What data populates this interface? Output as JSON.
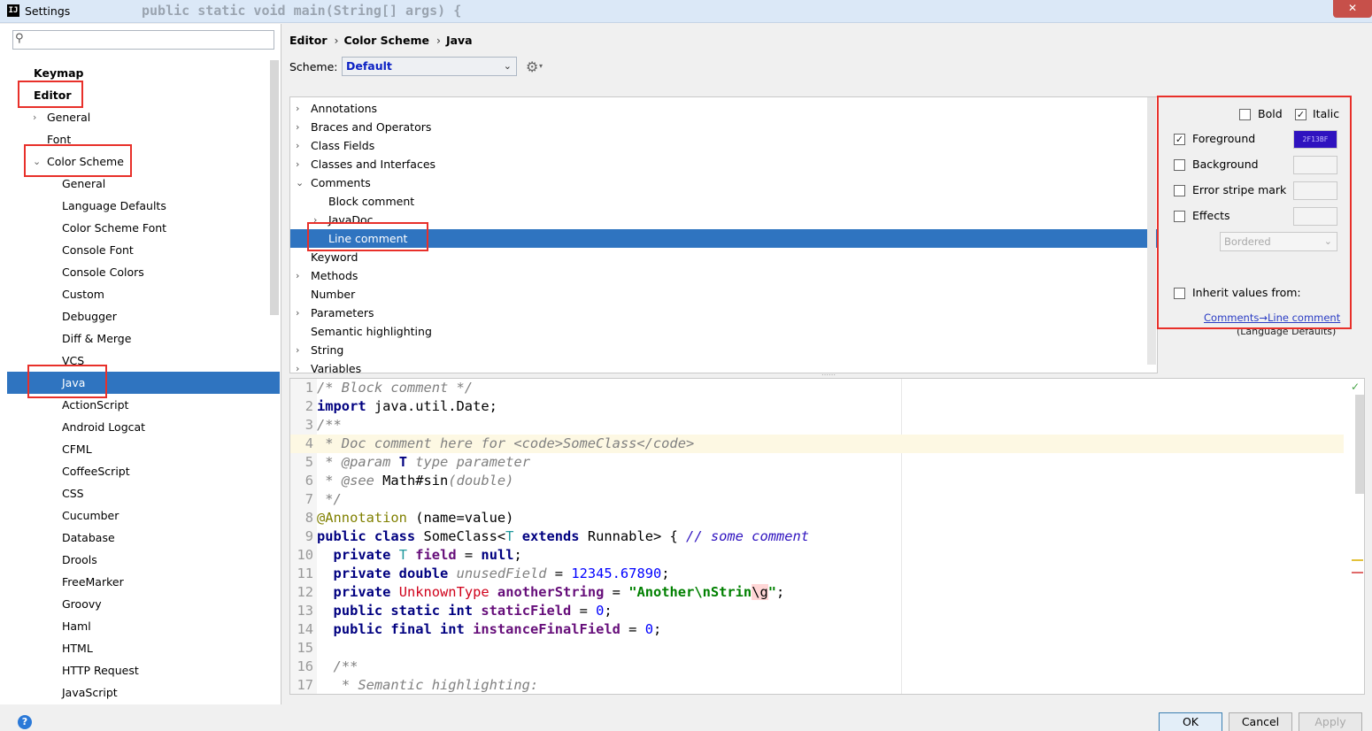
{
  "window": {
    "title": "Settings",
    "background_code": "public static void main(String[] args) {",
    "close_label": "✕"
  },
  "search": {
    "placeholder": ""
  },
  "left_tree": [
    {
      "label": "Keymap",
      "bold": true,
      "level": 0
    },
    {
      "label": "Editor",
      "bold": true,
      "level": 0,
      "expanded": true
    },
    {
      "label": "General",
      "level": 1,
      "arrow": "›"
    },
    {
      "label": "Font",
      "level": 1
    },
    {
      "label": "Color Scheme",
      "level": 1,
      "arrow": "⌄",
      "expanded": true
    },
    {
      "label": "General",
      "level": 2
    },
    {
      "label": "Language Defaults",
      "level": 2
    },
    {
      "label": "Color Scheme Font",
      "level": 2
    },
    {
      "label": "Console Font",
      "level": 2
    },
    {
      "label": "Console Colors",
      "level": 2
    },
    {
      "label": "Custom",
      "level": 2
    },
    {
      "label": "Debugger",
      "level": 2
    },
    {
      "label": "Diff & Merge",
      "level": 2
    },
    {
      "label": "VCS",
      "level": 2
    },
    {
      "label": "Java",
      "level": 2,
      "selected": true
    },
    {
      "label": "ActionScript",
      "level": 2
    },
    {
      "label": "Android Logcat",
      "level": 2
    },
    {
      "label": "CFML",
      "level": 2
    },
    {
      "label": "CoffeeScript",
      "level": 2
    },
    {
      "label": "CSS",
      "level": 2
    },
    {
      "label": "Cucumber",
      "level": 2
    },
    {
      "label": "Database",
      "level": 2
    },
    {
      "label": "Drools",
      "level": 2
    },
    {
      "label": "FreeMarker",
      "level": 2
    },
    {
      "label": "Groovy",
      "level": 2
    },
    {
      "label": "Haml",
      "level": 2
    },
    {
      "label": "HTML",
      "level": 2
    },
    {
      "label": "HTTP Request",
      "level": 2
    },
    {
      "label": "JavaScript",
      "level": 2
    }
  ],
  "breadcrumb": [
    "Editor",
    "Color Scheme",
    "Java"
  ],
  "breadcrumb_sep": "›",
  "scheme": {
    "label": "Scheme:",
    "value": "Default"
  },
  "categories": [
    {
      "label": "Annotations",
      "arrow": "›"
    },
    {
      "label": "Braces and Operators",
      "arrow": "›"
    },
    {
      "label": "Class Fields",
      "arrow": "›"
    },
    {
      "label": "Classes and Interfaces",
      "arrow": "›"
    },
    {
      "label": "Comments",
      "arrow": "⌄"
    },
    {
      "label": "Block comment",
      "indent": true
    },
    {
      "label": "JavaDoc",
      "indent": true,
      "arrow": "›"
    },
    {
      "label": "Line comment",
      "indent": true,
      "selected": true
    },
    {
      "label": "Keyword"
    },
    {
      "label": "Methods",
      "arrow": "›"
    },
    {
      "label": "Number"
    },
    {
      "label": "Parameters",
      "arrow": "›"
    },
    {
      "label": "Semantic highlighting"
    },
    {
      "label": "String",
      "arrow": "›"
    },
    {
      "label": "Variables",
      "arrow": "›"
    }
  ],
  "attributes": {
    "bold": {
      "label": "Bold",
      "checked": false
    },
    "italic": {
      "label": "Italic",
      "checked": true
    },
    "foreground": {
      "label": "Foreground",
      "checked": true,
      "color": "2F13BF"
    },
    "background": {
      "label": "Background",
      "checked": false
    },
    "error_stripe": {
      "label": "Error stripe mark",
      "checked": false
    },
    "effects": {
      "label": "Effects",
      "checked": false,
      "style": "Bordered"
    },
    "inherit": {
      "label": "Inherit values from:",
      "checked": false,
      "link": "Comments→Line comment",
      "sub": "(Language Defaults)"
    }
  },
  "colors": {
    "accent": "#2f74c0",
    "foreground_sample": "#2f13bf",
    "highlight_box": "#e8302a"
  },
  "code_lines": [
    {
      "n": "1",
      "segs": [
        [
          "c-com",
          "/* Block comment */"
        ]
      ]
    },
    {
      "n": "2",
      "segs": [
        [
          "c-kw",
          "import"
        ],
        [
          "",
          " java.util.Date;"
        ]
      ]
    },
    {
      "n": "3",
      "segs": [
        [
          "c-com",
          "/**"
        ]
      ]
    },
    {
      "n": "4",
      "hl": true,
      "segs": [
        [
          "c-com",
          " * Doc comment here for <code>SomeClass</code>"
        ]
      ]
    },
    {
      "n": "5",
      "segs": [
        [
          "c-com",
          " * "
        ],
        [
          "c-com",
          "@param"
        ],
        [
          "c-com",
          " "
        ],
        [
          "c-kw",
          "T"
        ],
        [
          "c-com",
          " type parameter"
        ]
      ]
    },
    {
      "n": "6",
      "segs": [
        [
          "c-com",
          " * "
        ],
        [
          "c-com",
          "@see"
        ],
        [
          "",
          " Math#sin"
        ],
        [
          "c-com",
          "(double)"
        ]
      ]
    },
    {
      "n": "7",
      "segs": [
        [
          "c-com",
          " */"
        ]
      ]
    },
    {
      "n": "8",
      "segs": [
        [
          "c-ann",
          "@Annotation"
        ],
        [
          "",
          " (name=value)"
        ]
      ]
    },
    {
      "n": "9",
      "segs": [
        [
          "c-kw",
          "public class"
        ],
        [
          "",
          " SomeClass<"
        ],
        [
          "c-tp",
          "T"
        ],
        [
          "",
          " "
        ],
        [
          "c-kw",
          "extends"
        ],
        [
          "",
          " Runnable> { "
        ],
        [
          "c-lc",
          "// some comment"
        ]
      ]
    },
    {
      "n": "10",
      "segs": [
        [
          "",
          "  "
        ],
        [
          "c-kw",
          "private"
        ],
        [
          "",
          " "
        ],
        [
          "c-tp",
          "T"
        ],
        [
          "",
          " "
        ],
        [
          "c-fld",
          "field"
        ],
        [
          "",
          " = "
        ],
        [
          "c-kw",
          "null"
        ],
        [
          "",
          ";"
        ]
      ]
    },
    {
      "n": "11",
      "segs": [
        [
          "",
          "  "
        ],
        [
          "c-kw",
          "private double"
        ],
        [
          "",
          " "
        ],
        [
          "c-com",
          "unusedField"
        ],
        [
          "",
          " = "
        ],
        [
          "c-num",
          "12345.67890"
        ],
        [
          "",
          ";"
        ]
      ]
    },
    {
      "n": "12",
      "segs": [
        [
          "",
          "  "
        ],
        [
          "c-kw",
          "private"
        ],
        [
          "",
          " "
        ],
        [
          "c-red",
          "UnknownType"
        ],
        [
          "",
          " "
        ],
        [
          "c-fld",
          "anotherString"
        ],
        [
          "",
          " = "
        ],
        [
          "c-str",
          "\"Another\\nStrin"
        ],
        [
          "c-esc",
          "\\g"
        ],
        [
          "c-str",
          "\""
        ],
        [
          "",
          ";"
        ]
      ]
    },
    {
      "n": "13",
      "segs": [
        [
          "",
          "  "
        ],
        [
          "c-kw",
          "public static int"
        ],
        [
          "",
          " "
        ],
        [
          "c-fld",
          "staticField"
        ],
        [
          "",
          " = "
        ],
        [
          "c-num",
          "0"
        ],
        [
          "",
          ";"
        ]
      ]
    },
    {
      "n": "14",
      "segs": [
        [
          "",
          "  "
        ],
        [
          "c-kw",
          "public final int"
        ],
        [
          "",
          " "
        ],
        [
          "c-fld",
          "instanceFinalField"
        ],
        [
          "",
          " = "
        ],
        [
          "c-num",
          "0"
        ],
        [
          "",
          ";"
        ]
      ]
    },
    {
      "n": "15",
      "segs": [
        [
          "",
          ""
        ]
      ]
    },
    {
      "n": "16",
      "segs": [
        [
          "",
          "  "
        ],
        [
          "c-com",
          "/**"
        ]
      ]
    },
    {
      "n": "17",
      "segs": [
        [
          "",
          "  "
        ],
        [
          "c-com",
          " * Semantic highlighting:"
        ]
      ]
    }
  ],
  "buttons": {
    "ok": "OK",
    "cancel": "Cancel",
    "apply": "Apply",
    "help": "?"
  }
}
